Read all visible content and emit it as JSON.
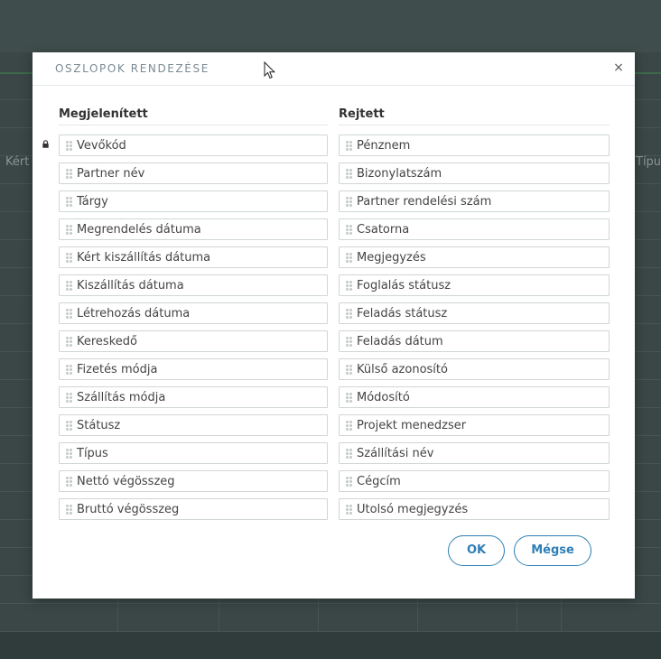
{
  "modal": {
    "title": "OSZLOPOK RENDEZÉSE",
    "close_symbol": "×",
    "ok_label": "OK",
    "cancel_label": "Mégse"
  },
  "background": {
    "left_label": "Kért",
    "right_label": "Típus"
  },
  "visible_column": {
    "title": "Megjelenített",
    "items": [
      {
        "label": "Vevőkód",
        "locked": true
      },
      {
        "label": "Partner név"
      },
      {
        "label": "Tárgy"
      },
      {
        "label": "Megrendelés dátuma"
      },
      {
        "label": "Kért kiszállítás dátuma"
      },
      {
        "label": "Kiszállítás dátuma"
      },
      {
        "label": "Létrehozás dátuma"
      },
      {
        "label": "Kereskedő"
      },
      {
        "label": "Fizetés módja"
      },
      {
        "label": "Szállítás módja"
      },
      {
        "label": "Státusz"
      },
      {
        "label": "Típus"
      },
      {
        "label": "Nettó végösszeg"
      },
      {
        "label": "Bruttó végösszeg"
      }
    ]
  },
  "hidden_column": {
    "title": "Rejtett",
    "items": [
      {
        "label": "Pénznem"
      },
      {
        "label": "Bizonylatszám"
      },
      {
        "label": "Partner rendelési szám"
      },
      {
        "label": "Csatorna"
      },
      {
        "label": "Megjegyzés"
      },
      {
        "label": "Foglalás státusz"
      },
      {
        "label": "Feladás státusz"
      },
      {
        "label": "Feladás dátum"
      },
      {
        "label": "Külső azonosító"
      },
      {
        "label": "Módosító"
      },
      {
        "label": "Projekt menedzser"
      },
      {
        "label": "Szállítási név"
      },
      {
        "label": "Cégcím"
      },
      {
        "label": "Utolsó megjegyzés"
      }
    ]
  },
  "colors": {
    "accent": "#2f7fb5",
    "overlay": "#3a4746"
  },
  "icons": [
    "close-icon",
    "drag-handle-icon",
    "lock-icon",
    "mouse-cursor-icon"
  ]
}
